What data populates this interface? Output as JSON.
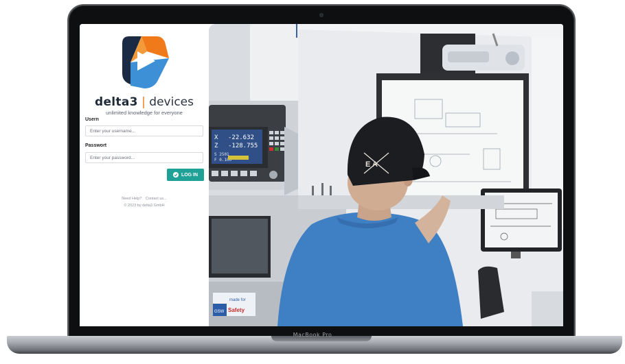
{
  "device": {
    "brand_label": "MacBook Pro"
  },
  "login": {
    "brand": {
      "word1": "delta3",
      "separator": "|",
      "word2": "devices"
    },
    "tagline": "unlimited knowledge for everyone",
    "username": {
      "label": "Usern",
      "placeholder": "Enter your username..."
    },
    "password": {
      "label": "Passwort",
      "placeholder": "Enter your password..."
    },
    "button_label": "LOG IN",
    "help_link": "Need Help?",
    "contact_link": "Contact us...",
    "copyright": "© 2023 by delta3 GmbH"
  },
  "scene": {
    "machine_display": {
      "x_label": "X",
      "x_value": "-22.632",
      "z_label": "Z",
      "z_value": "-128.755",
      "s_value": "S 2501",
      "f_value": "F 0.100"
    },
    "sign": {
      "line1": "made for",
      "line2": "Safety",
      "logo": "GSW"
    },
    "cap_logo": "E A"
  },
  "colors": {
    "accent": "#1fa197",
    "logo_orange": "#f07a1a",
    "logo_navy": "#1b2b44",
    "logo_blue": "#3d8fd6",
    "shirt_blue": "#3f7fc4"
  }
}
